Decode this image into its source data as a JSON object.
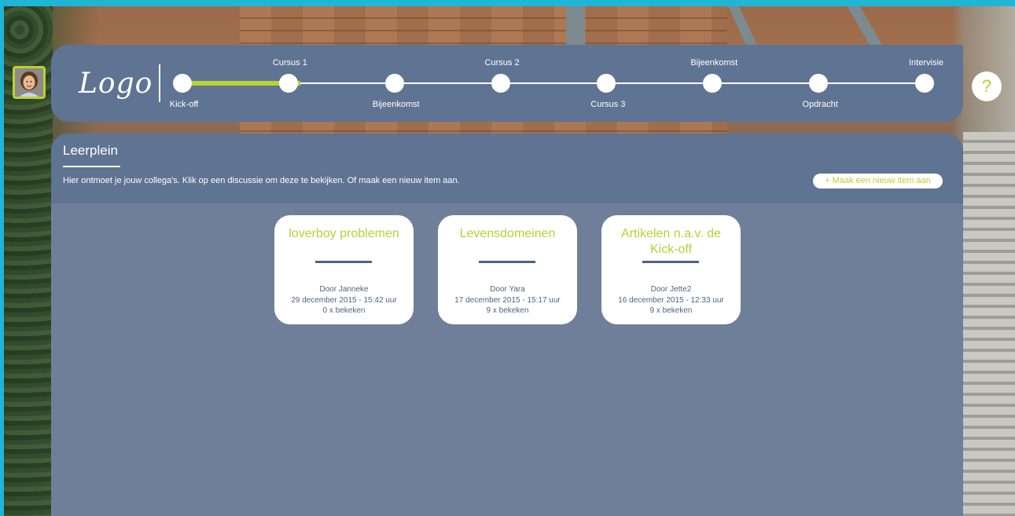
{
  "header": {
    "logo_text": "Logo",
    "help_label": "?",
    "milestones": [
      {
        "label": "Kick-off",
        "position": "below",
        "completed": true
      },
      {
        "label": "Cursus 1",
        "position": "above",
        "completed": true
      },
      {
        "label": "Bijeenkomst",
        "position": "below",
        "completed": false
      },
      {
        "label": "Cursus 2",
        "position": "above",
        "completed": false
      },
      {
        "label": "Cursus 3",
        "position": "below",
        "completed": false
      },
      {
        "label": "Bijeenkomst",
        "position": "above",
        "completed": false
      },
      {
        "label": "Opdracht",
        "position": "below",
        "completed": false
      },
      {
        "label": "Intervisie",
        "position": "above",
        "completed": false
      }
    ]
  },
  "page": {
    "title": "Leerplein",
    "intro": "Hier ontmoet je jouw collega's. Klik op een discussie om deze te bekijken. Of maak een nieuw item aan.",
    "new_item_label": "+ Maak een nieuw item aan"
  },
  "items": [
    {
      "title": "loverboy problemen",
      "author": "Door Janneke",
      "date": "29 december 2015 - 15:42 uur",
      "views": "0 x bekeken"
    },
    {
      "title": "Levensdomeinen",
      "author": "Door Yara",
      "date": "17 december 2015 - 15:17 uur",
      "views": "9 x bekeken"
    },
    {
      "title": "Artikelen n.a.v. de Kick-off",
      "author": "Door Jette2",
      "date": "16 december 2015 - 12:33 uur",
      "views": "9 x bekeken"
    }
  ],
  "colors": {
    "accent": "#b8d135",
    "header_bg": "#5f7393",
    "panel_bg": "#6f7f9a",
    "frame": "#1fb6d6",
    "text_dark": "#4e6485"
  }
}
